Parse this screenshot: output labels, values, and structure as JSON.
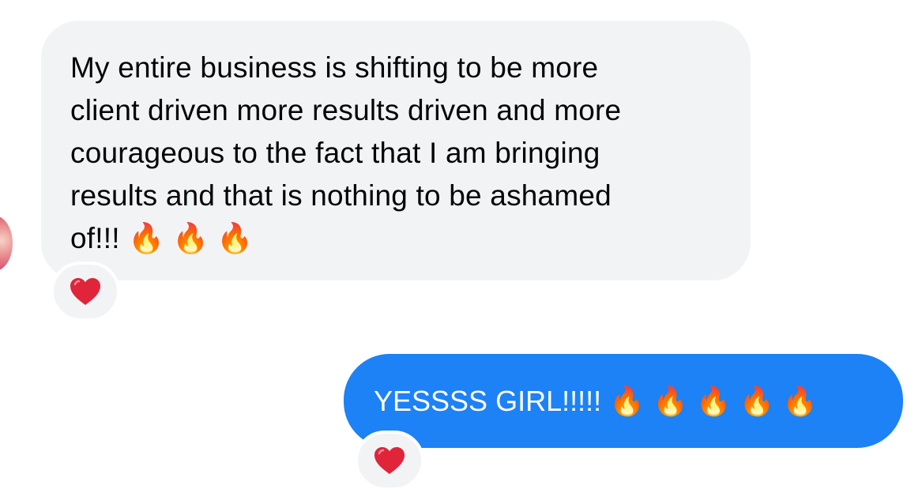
{
  "incoming": {
    "lines": [
      "My entire business is shifting to be more",
      "client driven more results driven and more",
      "courageous to the fact that I am bringing",
      "results and that is nothing to be ashamed",
      "of!!!"
    ],
    "emoji": "🔥🔥🔥",
    "reaction": "❤️"
  },
  "outgoing": {
    "text": "YESSSS GIRL!!!!!",
    "emoji": "🔥🔥🔥🔥🔥",
    "reaction": "❤️"
  },
  "colors": {
    "incoming_bubble": "#f2f3f5",
    "outgoing_bubble": "#1c82f5",
    "heart": "#e0243a"
  }
}
